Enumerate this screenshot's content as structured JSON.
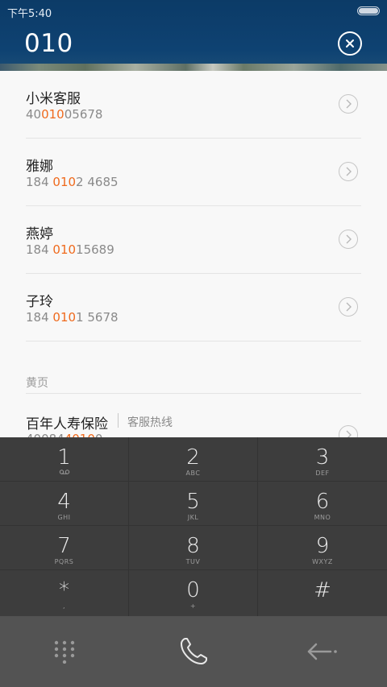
{
  "status_bar": {
    "time": "下午5:40"
  },
  "header": {
    "dialed_number": "010"
  },
  "contacts": [
    {
      "name": "小米客服",
      "number_pre": "40",
      "number_match": "010",
      "number_post": "05678"
    },
    {
      "name": "雅娜",
      "number_pre": "184 ",
      "number_match": "010",
      "number_post": "2 4685"
    },
    {
      "name": "燕婷",
      "number_pre": "184 ",
      "number_match": "010",
      "number_post": "15689"
    },
    {
      "name": "子玲",
      "number_pre": "184 ",
      "number_match": "010",
      "number_post": "1 5678"
    }
  ],
  "yellow_pages": {
    "label": "黄页",
    "entry": {
      "name": "百年人寿保险",
      "tag": "客服热线",
      "number_pre": "40084",
      "number_match": "4010",
      "number_post": "0"
    }
  },
  "keypad": [
    {
      "digit": "1",
      "letters": "oo"
    },
    {
      "digit": "2",
      "letters": "ABC"
    },
    {
      "digit": "3",
      "letters": "DEF"
    },
    {
      "digit": "4",
      "letters": "GHI"
    },
    {
      "digit": "5",
      "letters": "JKL"
    },
    {
      "digit": "6",
      "letters": "MNO"
    },
    {
      "digit": "7",
      "letters": "PQRS"
    },
    {
      "digit": "8",
      "letters": "TUV"
    },
    {
      "digit": "9",
      "letters": "WXYZ"
    },
    {
      "digit": "*",
      "letters": ","
    },
    {
      "digit": "0",
      "letters": "+"
    },
    {
      "digit": "#",
      "letters": ""
    }
  ],
  "colors": {
    "header_bg": "#0e4272",
    "highlight": "#ef6a1d",
    "keypad_bg": "#3d3d3d",
    "bottom_bar_bg": "#535353"
  },
  "icons": {
    "clear": "close-circle-icon",
    "contact_detail": "chevron-right-circle-icon",
    "dialpad": "dialpad-icon",
    "call": "phone-icon",
    "backspace": "backspace-arrow-icon"
  }
}
